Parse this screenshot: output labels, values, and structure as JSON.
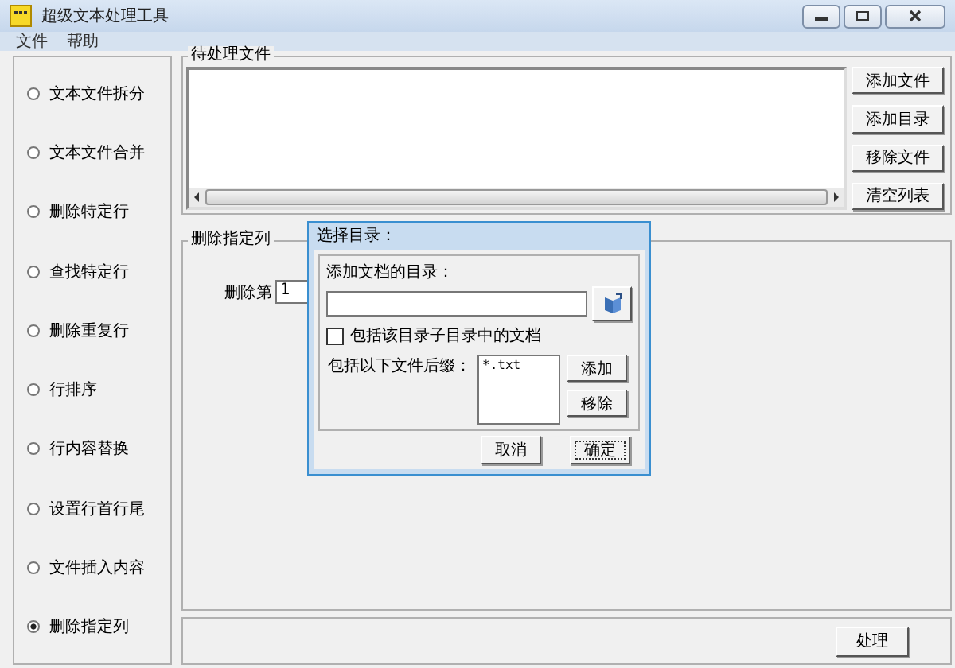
{
  "window": {
    "title": "超级文本处理工具"
  },
  "menu": [
    "文件",
    "帮助"
  ],
  "modes": [
    {
      "label": "文本文件拆分",
      "selected": false
    },
    {
      "label": "文本文件合并",
      "selected": false
    },
    {
      "label": "删除特定行",
      "selected": false
    },
    {
      "label": "查找特定行",
      "selected": false
    },
    {
      "label": "删除重复行",
      "selected": false
    },
    {
      "label": "行排序",
      "selected": false
    },
    {
      "label": "行内容替换",
      "selected": false
    },
    {
      "label": "设置行首行尾",
      "selected": false
    },
    {
      "label": "文件插入内容",
      "selected": false
    },
    {
      "label": "删除指定列",
      "selected": true
    }
  ],
  "file_group": {
    "title": "待处理文件",
    "buttons": [
      "添加文件",
      "添加目录",
      "移除文件",
      "清空列表"
    ]
  },
  "column_group": {
    "title": "删除指定列",
    "label": "删除第",
    "value": "1"
  },
  "process_button": "处理",
  "dialog": {
    "title": "选择目录：",
    "dir_label": "添加文档的目录：",
    "subdir_label": "包括该目录子目录中的文档",
    "subdir_checked": false,
    "suffix_label": "包括以下文件后缀：",
    "suffixes": [
      "*.txt"
    ],
    "suffix_buttons": [
      "添加",
      "移除"
    ],
    "cancel": "取消",
    "ok": "确定"
  }
}
